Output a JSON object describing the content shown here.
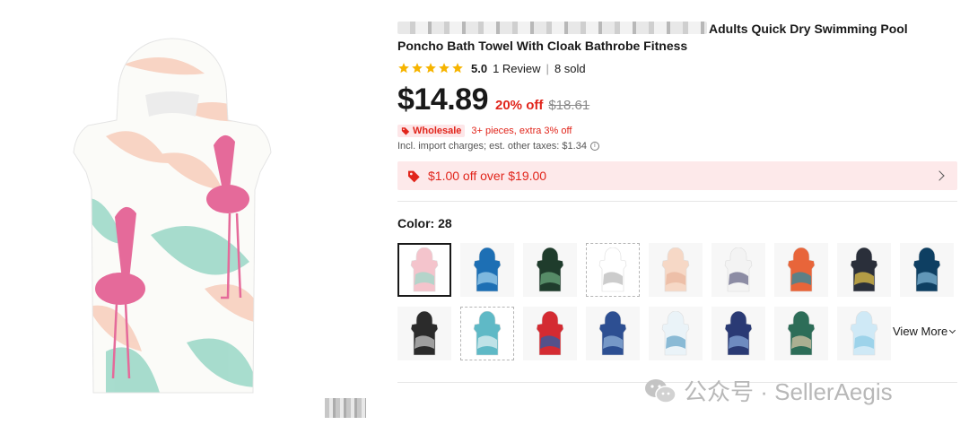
{
  "product": {
    "title_line1": "Adults Quick Dry Swimming Pool",
    "title_line2": "Poncho Bath Towel With Cloak Bathrobe Fitness",
    "rating": "5.0",
    "reviews": "1 Review",
    "sold": "8 sold",
    "price": "$14.89",
    "discount": "20% off",
    "original_price": "$18.61",
    "wholesale_badge": "Wholesale",
    "wholesale_text": "3+ pieces, extra 3% off",
    "tax_text": "Incl. import charges; est. other taxes: $1.34",
    "coupon_text": "$1.00 off over $19.00",
    "color_label": "Color: 28",
    "view_more": "View More"
  },
  "colors": {
    "accent_red": "#e1251b",
    "star_yellow": "#f6b400",
    "coupon_bg": "#fde9ea"
  },
  "swatches": [
    {
      "icon": "flamingo-towel",
      "palette": [
        "#f4c4cc",
        "#9fd9c9"
      ],
      "selected": true
    },
    {
      "icon": "palm-blue-towel",
      "palette": [
        "#1d6fb4",
        "#9fd0ee"
      ]
    },
    {
      "icon": "tropical-green-towel",
      "palette": [
        "#1f3c2c",
        "#6aa57b"
      ]
    },
    {
      "icon": "line-art-towel",
      "palette": [
        "#ffffff",
        "#bbbbbb"
      ],
      "dashed": true
    },
    {
      "icon": "peach-leaf-towel",
      "palette": [
        "#f6d8c6",
        "#e9b79d"
      ]
    },
    {
      "icon": "pattern-towel",
      "palette": [
        "#f3f3f3",
        "#6a6a8a"
      ]
    },
    {
      "icon": "aztec-orange-towel",
      "palette": [
        "#e8653a",
        "#2f8aa0"
      ]
    },
    {
      "icon": "aztec-yellow-towel",
      "palette": [
        "#2a2f3a",
        "#e2c14a"
      ]
    },
    {
      "icon": "ocean-wave-towel",
      "palette": [
        "#0e3f62",
        "#7fb6d6"
      ]
    },
    {
      "icon": "mountain-towel",
      "palette": [
        "#2b2b2b",
        "#c7c7c7"
      ]
    },
    {
      "icon": "tie-dye-towel",
      "palette": [
        "#5fb9c6",
        "#dff0f2"
      ],
      "dashed": true
    },
    {
      "icon": "shark-towel",
      "palette": [
        "#d42b32",
        "#2a5fa8"
      ]
    },
    {
      "icon": "indigo-stripe-towel",
      "palette": [
        "#2d4f92",
        "#8fb0d8"
      ]
    },
    {
      "icon": "wave-white-towel",
      "palette": [
        "#eaf3f8",
        "#6aa7c9"
      ]
    },
    {
      "icon": "navy-dolphin-towel",
      "palette": [
        "#2a3a74",
        "#86a7d8"
      ]
    },
    {
      "icon": "turtle-towel",
      "palette": [
        "#2d6d58",
        "#d6c6a6"
      ]
    },
    {
      "icon": "light-blue-towel",
      "palette": [
        "#cfe9f6",
        "#8ccbe6"
      ]
    }
  ],
  "watermark": {
    "text": "公众号 · SellerAegis",
    "icon": "wechat-icon"
  }
}
